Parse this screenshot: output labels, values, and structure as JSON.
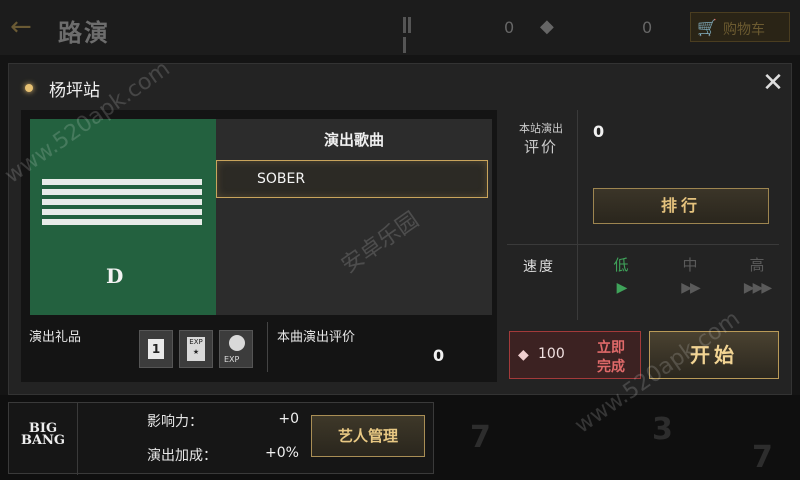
{
  "topbar": {
    "back_icon": "left-arrow-icon",
    "title": "路演",
    "currency1_icon": "bars-icon",
    "currency1_value": "0",
    "currency2_icon": "diamond-icon",
    "currency2_value": "0",
    "cart_icon": "cart-icon",
    "cart_label": "购物车"
  },
  "dialog": {
    "station_name": "杨坪站",
    "close_icon": "close-icon",
    "song_header": "演出歌曲",
    "songs": [
      {
        "name": "SOBER",
        "selected": true
      }
    ],
    "album_logo": "D",
    "gift_label": "演出礼品",
    "gifts": [
      {
        "icon": "card-1-icon",
        "text": "1"
      },
      {
        "icon": "exp-star-icon",
        "text": "EXP"
      },
      {
        "icon": "artist-exp-icon",
        "text": "EXP"
      }
    ],
    "song_eval_label": "本曲演出评价",
    "song_eval_value": "0",
    "station_eval_label_top": "本站演出",
    "station_eval_label_bottom": "评价",
    "station_eval_value": "0",
    "rank_button": "排行",
    "speed_label": "速度",
    "speed_options": [
      {
        "label": "低",
        "arrows": "▶",
        "active": true
      },
      {
        "label": "中",
        "arrows": "▶▶",
        "active": false
      },
      {
        "label": "高",
        "arrows": "▶▶▶",
        "active": false
      }
    ],
    "finish_cost": "100",
    "finish_label_1": "立即",
    "finish_label_2": "完成",
    "start_button": "开始"
  },
  "bottom": {
    "logo_line1": "BIG",
    "logo_line2": "BANG",
    "influence_label": "影响力：",
    "influence_value": "+0",
    "bonus_label": "演出加成：",
    "bonus_value": "+0%",
    "artist_button": "艺人管理"
  },
  "watermarks": [
    "www.520apk.com",
    "安卓乐园",
    "www.520apk.com"
  ],
  "colors": {
    "accent_gold": "#c9a45c",
    "active_green": "#3fa35a",
    "finish_red": "#a33a3a",
    "album_green": "#23613f"
  }
}
